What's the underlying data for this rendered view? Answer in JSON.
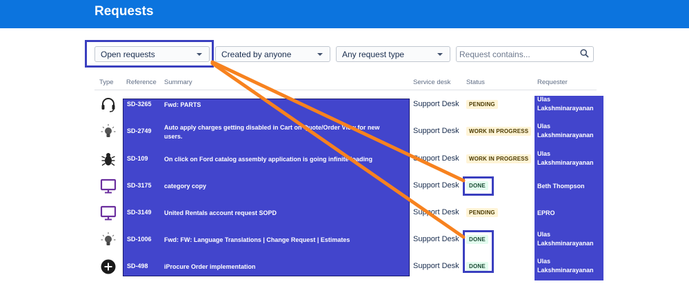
{
  "header": {
    "title": "Requests"
  },
  "filters": {
    "status": "Open requests",
    "created_by": "Created by anyone",
    "request_type": "Any request type",
    "search_placeholder": "Request contains..."
  },
  "columns": {
    "type": "Type",
    "reference": "Reference",
    "summary": "Summary",
    "service_desk": "Service desk",
    "status": "Status",
    "requester": "Requester"
  },
  "rows": [
    {
      "type_icon": "headset-icon",
      "reference": "SD-3265",
      "summary": "Fwd: PARTS",
      "service_desk": "Support Desk",
      "status": "PENDING",
      "requester": "Ulas Lakshminarayanan"
    },
    {
      "type_icon": "lightbulb-icon",
      "reference": "SD-2749",
      "summary": "Auto apply charges getting disabled in Cart on Quote/Order View for new users.",
      "service_desk": "Support Desk",
      "status": "WORK IN PROGRESS",
      "requester": "Ulas Lakshminarayanan"
    },
    {
      "type_icon": "bug-icon",
      "reference": "SD-109",
      "summary": "On click on Ford catalog assembly application is going infinite loading",
      "service_desk": "Support Desk",
      "status": "WORK IN PROGRESS",
      "requester": "Ulas Lakshminarayanan"
    },
    {
      "type_icon": "monitor-icon",
      "reference": "SD-3175",
      "summary": "category copy",
      "service_desk": "Support Desk",
      "status": "DONE",
      "requester": "Beth Thompson"
    },
    {
      "type_icon": "monitor-icon",
      "reference": "SD-3149",
      "summary": "United Rentals account request SOPD",
      "service_desk": "Support Desk",
      "status": "PENDING",
      "requester": "EPRO"
    },
    {
      "type_icon": "lightbulb-icon",
      "reference": "SD-1006",
      "summary": "Fwd: FW: Language Translations | Change Request | Estimates",
      "service_desk": "Support Desk",
      "status": "DONE",
      "requester": "Ulas Lakshminarayanan"
    },
    {
      "type_icon": "plus-circle-icon",
      "reference": "SD-498",
      "summary": "iProcure Order implementation",
      "service_desk": "Support Desk",
      "status": "DONE",
      "requester": "Ulas Lakshminarayanan"
    }
  ],
  "colors": {
    "brand": "#0c74de",
    "redaction": "#4245cc",
    "highlight_box": "#3a3fbf",
    "annotation_arrow": "#f7821f"
  }
}
